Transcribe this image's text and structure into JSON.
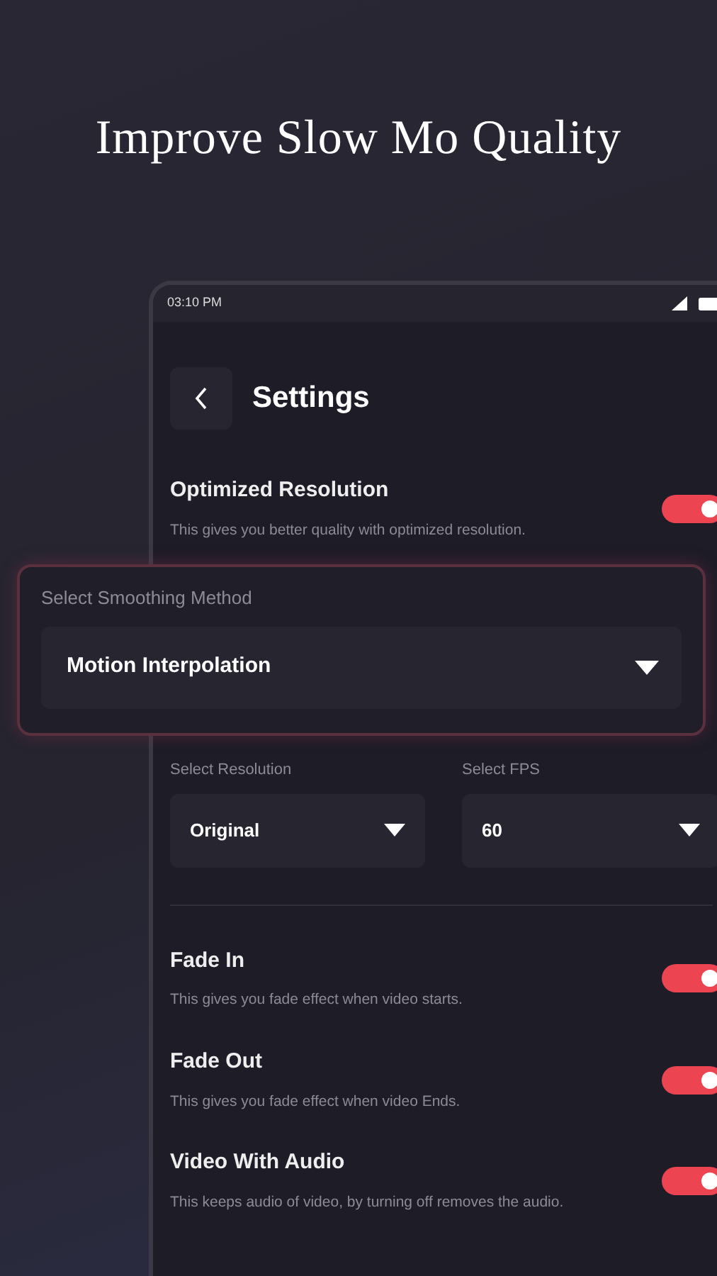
{
  "headline": "Improve Slow Mo Quality",
  "status_bar": {
    "time": "03:10 PM"
  },
  "header": {
    "title": "Settings"
  },
  "top_toggles": [
    {
      "title": "Optimized Resolution",
      "description": "This gives you better quality with optimized resolution.",
      "on": true
    }
  ],
  "smoothing": {
    "label": "Select Smoothing Method",
    "value": "Motion Interpolation"
  },
  "selects": [
    {
      "label": "Select Resolution",
      "value": "Original"
    },
    {
      "label": "Select FPS",
      "value": "60"
    }
  ],
  "bottom_toggles": [
    {
      "title": "Fade In",
      "description": "This gives you fade effect when video starts.",
      "on": true
    },
    {
      "title": "Fade Out",
      "description": "This gives you fade effect when video Ends.",
      "on": true
    },
    {
      "title": "Video With Audio",
      "description": "This keeps audio of video, by turning off removes the audio.",
      "on": true
    }
  ]
}
